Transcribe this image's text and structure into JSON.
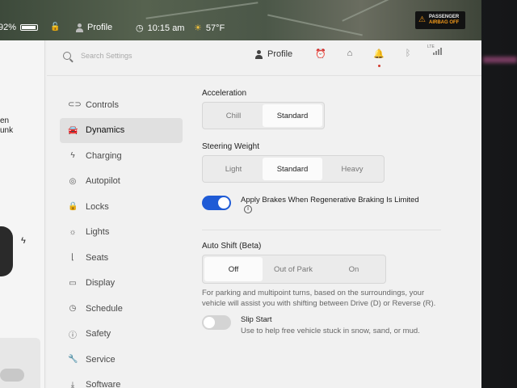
{
  "status_bar": {
    "battery": "92%",
    "profile": "Profile",
    "time": "10:15 am",
    "temperature": "57°F",
    "airbag_line1": "PASSENGER",
    "airbag_line2": "AIRBAG OFF"
  },
  "car_preview": {
    "text_line1": "en",
    "text_line2": "unk"
  },
  "topbar": {
    "search_placeholder": "Search Settings",
    "profile_label": "Profile",
    "lte": "LTE"
  },
  "nav": {
    "items": [
      {
        "label": "Controls",
        "icon": "toggle-icon"
      },
      {
        "label": "Dynamics",
        "icon": "car-icon",
        "active": true
      },
      {
        "label": "Charging",
        "icon": "bolt-icon"
      },
      {
        "label": "Autopilot",
        "icon": "steering-wheel-icon"
      },
      {
        "label": "Locks",
        "icon": "lock-icon"
      },
      {
        "label": "Lights",
        "icon": "light-icon"
      },
      {
        "label": "Seats",
        "icon": "seat-icon"
      },
      {
        "label": "Display",
        "icon": "display-icon"
      },
      {
        "label": "Schedule",
        "icon": "clock-icon"
      },
      {
        "label": "Safety",
        "icon": "safety-icon"
      },
      {
        "label": "Service",
        "icon": "wrench-icon"
      },
      {
        "label": "Software",
        "icon": "download-icon"
      }
    ]
  },
  "acceleration": {
    "label": "Acceleration",
    "options": [
      "Chill",
      "Standard"
    ],
    "selected": "Standard"
  },
  "steering_weight": {
    "label": "Steering Weight",
    "options": [
      "Light",
      "Standard",
      "Heavy"
    ],
    "selected": "Standard"
  },
  "regen_braking": {
    "label": "Apply Brakes When Regenerative Braking Is Limited",
    "enabled": true
  },
  "auto_shift": {
    "label": "Auto Shift (Beta)",
    "options": [
      "Off",
      "Out of Park",
      "On"
    ],
    "selected": "Off",
    "description": "For parking and multipoint turns, based on the surroundings, your vehicle will assist you with shifting between Drive (D) or Reverse (R)."
  },
  "slip_start": {
    "label": "Slip Start",
    "description": "Use to help free vehicle stuck in snow, sand, or mud.",
    "enabled": false
  },
  "colors": {
    "toggle_on": "#1f5bd6",
    "panel_bg": "#f1f1f1",
    "selected_segment": "#fbfbfb"
  }
}
